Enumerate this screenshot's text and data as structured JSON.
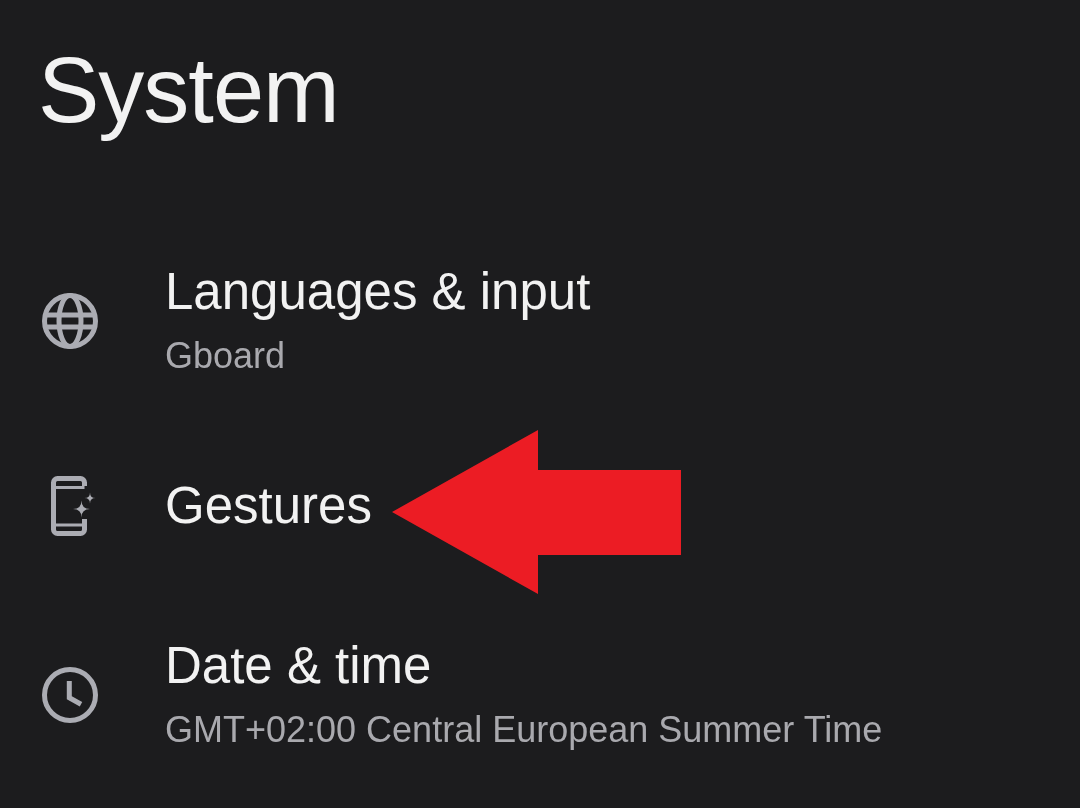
{
  "title": "System",
  "items": [
    {
      "title": "Languages & input",
      "summary": "Gboard",
      "marked_by_arrow": false
    },
    {
      "title": "Gestures",
      "marked_by_arrow": true
    },
    {
      "title": "Date & time",
      "summary": "GMT+02:00 Central European Summer Time",
      "marked_by_arrow": false
    }
  ]
}
